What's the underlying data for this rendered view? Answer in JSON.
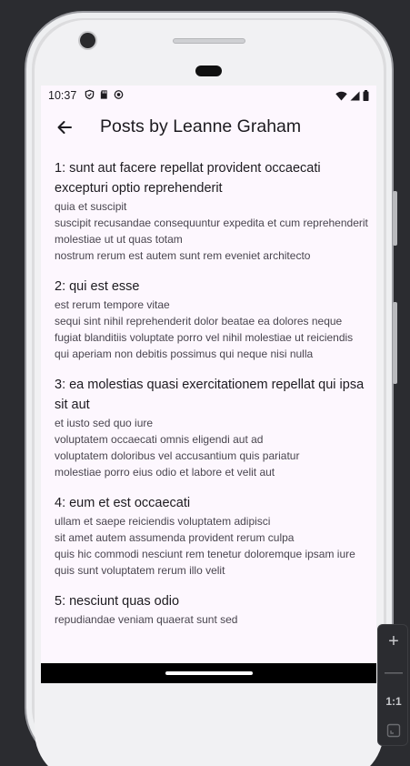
{
  "status_bar": {
    "time": "10:37"
  },
  "app_bar": {
    "title": "Posts by Leanne Graham"
  },
  "posts": [
    {
      "title": "1: sunt aut facere repellat provident occaecati excepturi optio reprehenderit",
      "body": "quia et suscipit\nsuscipit recusandae consequuntur expedita et cum reprehenderit molestiae ut ut quas totam\nnostrum rerum est autem sunt rem eveniet architecto"
    },
    {
      "title": "2: qui est esse",
      "body": "est rerum tempore vitae\nsequi sint nihil reprehenderit dolor beatae ea dolores neque\nfugiat blanditiis voluptate porro vel nihil molestiae ut reiciendis\nqui aperiam non debitis possimus qui neque nisi nulla"
    },
    {
      "title": "3: ea molestias quasi exercitationem repellat qui ipsa sit aut",
      "body": "et iusto sed quo iure\nvoluptatem occaecati omnis eligendi aut ad\nvoluptatem doloribus vel accusantium quis pariatur\nmolestiae porro eius odio et labore et velit aut"
    },
    {
      "title": "4: eum et est occaecati",
      "body": "ullam et saepe reiciendis voluptatem adipisci\nsit amet autem assumenda provident rerum culpa\nquis hic commodi nesciunt rem tenetur doloremque ipsam iure\nquis sunt voluptatem rerum illo velit"
    },
    {
      "title": "5: nesciunt quas odio",
      "body": "repudiandae veniam quaerat sunt sed"
    }
  ],
  "emulator_controls": {
    "zoom_in": "+",
    "zoom_out": "—",
    "actual_size": "1:1"
  }
}
